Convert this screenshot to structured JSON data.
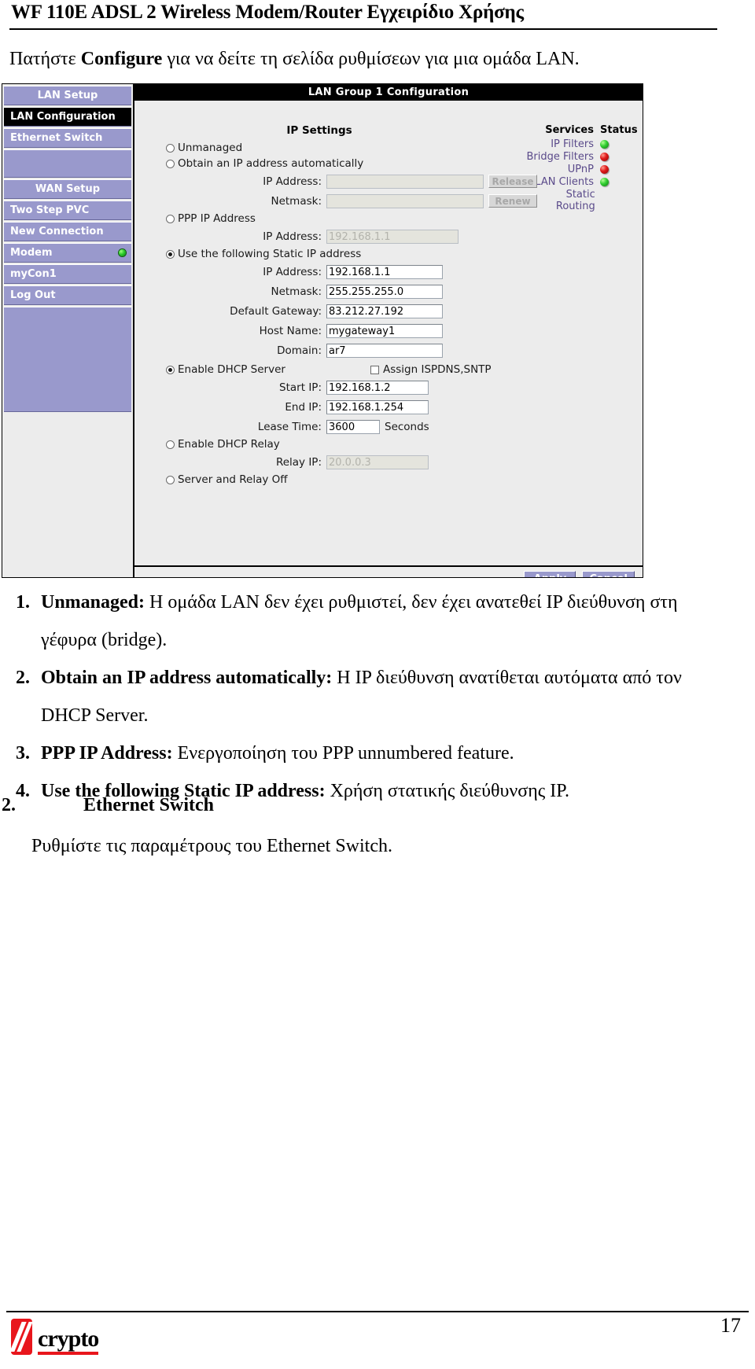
{
  "header": {
    "title": "WF 110E ADSL 2 Wireless Modem/Router Εγχειρίδιο Χρήσης"
  },
  "intro": {
    "before": "Πατήστε ",
    "bold": "Configure",
    "after": " για να δείτε τη σελίδα ρυθμίσεων για μια ομάδα LAN."
  },
  "router_ui": {
    "titlebar": "LAN Group 1 Configuration",
    "ip_settings_heading": "IP Settings",
    "nav": {
      "items": [
        {
          "label": "LAN Setup",
          "style": "header",
          "active": false,
          "led": false
        },
        {
          "label": "LAN Configuration",
          "style": "item",
          "active": true,
          "led": false
        },
        {
          "label": "Ethernet Switch",
          "style": "item",
          "active": false,
          "led": false
        },
        {
          "label": "",
          "style": "blank",
          "active": false,
          "led": false
        },
        {
          "label": "WAN Setup",
          "style": "header",
          "active": false,
          "led": false
        },
        {
          "label": "Two Step PVC",
          "style": "item",
          "active": false,
          "led": false
        },
        {
          "label": "New Connection",
          "style": "item",
          "active": false,
          "led": false
        },
        {
          "label": "Modem",
          "style": "item",
          "active": false,
          "led": true
        },
        {
          "label": "myCon1",
          "style": "item",
          "active": false,
          "led": false
        },
        {
          "label": "Log Out",
          "style": "item",
          "active": false,
          "led": false
        }
      ]
    },
    "options": {
      "unmanaged": "Unmanaged",
      "obtain_auto": "Obtain an IP address automatically",
      "ppp_ip": "PPP IP Address",
      "static_ip": "Use the following Static IP address",
      "enable_dhcp_server": "Enable DHCP Server",
      "assign_ispdns": "Assign ISPDNS,SNTP",
      "enable_dhcp_relay": "Enable DHCP Relay",
      "server_relay_off": "Server and Relay Off",
      "selected_ip_mode": "static_ip",
      "selected_dhcp_mode": "enable_dhcp_server",
      "assign_ispdns_checked": false
    },
    "fields": {
      "auto_ip_label": "IP Address:",
      "auto_ip_value": "",
      "auto_netmask_label": "Netmask:",
      "auto_netmask_value": "",
      "release_button": "Release",
      "renew_button": "Renew",
      "ppp_ip_label": "IP Address:",
      "ppp_ip_value": "192.168.1.1",
      "static_ip_label": "IP Address:",
      "static_ip_value": "192.168.1.1",
      "netmask_label": "Netmask:",
      "netmask_value": "255.255.255.0",
      "gateway_label": "Default Gateway:",
      "gateway_value": "83.212.27.192",
      "hostname_label": "Host Name:",
      "hostname_value": "mygateway1",
      "domain_label": "Domain:",
      "domain_value": "ar7",
      "start_ip_label": "Start IP:",
      "start_ip_value": "192.168.1.2",
      "end_ip_label": "End IP:",
      "end_ip_value": "192.168.1.254",
      "lease_time_label": "Lease Time:",
      "lease_time_value": "3600",
      "lease_time_unit": "Seconds",
      "relay_ip_label": "Relay IP:",
      "relay_ip_value": "20.0.0.3"
    },
    "services": {
      "col_services": "Services",
      "col_status": "Status",
      "rows": [
        {
          "name": "IP Filters",
          "status": "green"
        },
        {
          "name": "Bridge Filters",
          "status": "red"
        },
        {
          "name": "UPnP",
          "status": "red"
        },
        {
          "name": "LAN Clients",
          "status": "green"
        },
        {
          "name": "Static Routing",
          "status": "none"
        }
      ]
    },
    "buttons": {
      "apply": "Apply",
      "cancel": "Cancel"
    }
  },
  "list": [
    {
      "num": "1.",
      "bold": "Unmanaged:",
      "text": " Η ομάδα LAN δεν έχει ρυθμιστεί, δεν έχει ανατεθεί IP διεύθυνση στη γέφυρα (bridge)."
    },
    {
      "num": "2.",
      "bold": "Obtain an IP address automatically:",
      "text": " Η IP διεύθυνση ανατίθεται αυτόματα από τον DHCP Server."
    },
    {
      "num": "3.",
      "bold": "PPP IP Address:",
      "text": " Ενεργοποίηση του PPP unnumbered feature."
    },
    {
      "num": "4.",
      "bold": "Use the following Static IP address:",
      "text": " Χρήση στατικής διεύθυνσης IP."
    }
  ],
  "section2": {
    "num": "2.",
    "heading": "Ethernet Switch",
    "paragraph": "Ρυθμίστε τις παραμέτρους του Ethernet Switch."
  },
  "footer": {
    "page_number": "17",
    "logo_text": "crypto"
  }
}
